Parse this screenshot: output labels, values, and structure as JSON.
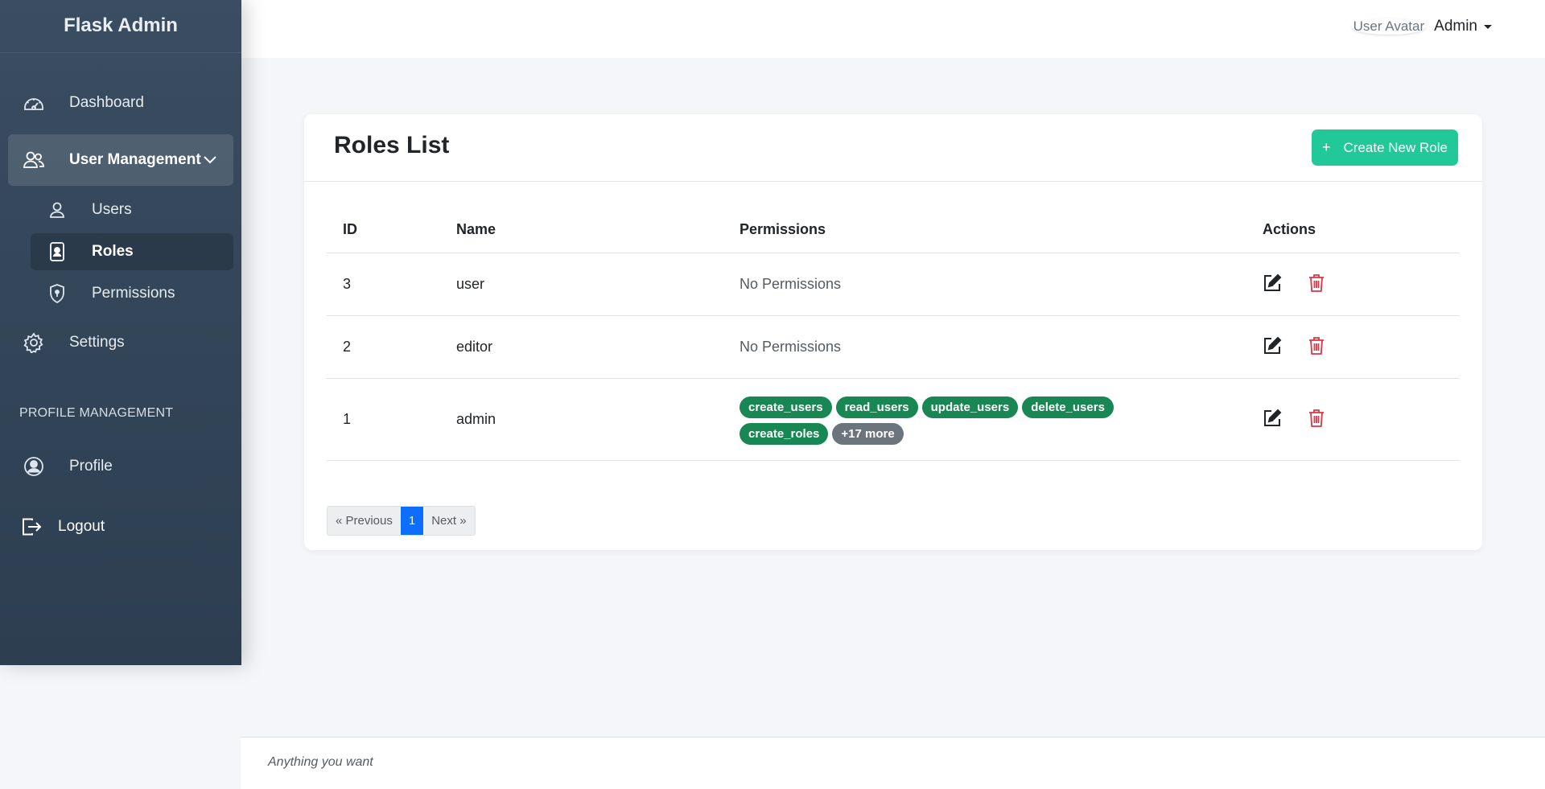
{
  "app": {
    "brand": "Flask Admin"
  },
  "sidebar": {
    "items": [
      {
        "label": "Dashboard",
        "icon": "dashboard-gauge-icon"
      },
      {
        "label": "User Management",
        "icon": "users-icon",
        "expanded": true
      },
      {
        "label": "Users",
        "icon": "user-icon"
      },
      {
        "label": "Roles",
        "icon": "id-badge-icon",
        "active": true
      },
      {
        "label": "Permissions",
        "icon": "shield-icon"
      },
      {
        "label": "Settings",
        "icon": "gear-icon"
      }
    ],
    "section_label": "PROFILE MANAGEMENT",
    "profile": {
      "label": "Profile",
      "icon": "user-circle-icon"
    },
    "logout": {
      "label": "Logout",
      "icon": "logout-icon"
    }
  },
  "topbar": {
    "avatar_alt": "User Avatar",
    "user_name": "Admin"
  },
  "card": {
    "title": "Roles List",
    "create_button": "Create New Role",
    "columns": [
      "ID",
      "Name",
      "Permissions",
      "Actions"
    ],
    "rows": [
      {
        "id": "3",
        "name": "user",
        "permissions_text": "No Permissions"
      },
      {
        "id": "2",
        "name": "editor",
        "permissions_text": "No Permissions"
      },
      {
        "id": "1",
        "name": "admin",
        "permissions": [
          "create_users",
          "read_users",
          "update_users",
          "delete_users",
          "create_roles"
        ],
        "more": "+17 more"
      }
    ]
  },
  "pagination": {
    "prev": "« Previous",
    "current": "1",
    "next": "Next »"
  },
  "footer": {
    "text": "Anything you want"
  },
  "colors": {
    "sidebar": "#2c3e50",
    "accent_create": "#20c997",
    "badge_green": "#198754",
    "badge_gray": "#6c757d",
    "pagination_active": "#0d6efd",
    "delete_red": "#dc3545"
  }
}
